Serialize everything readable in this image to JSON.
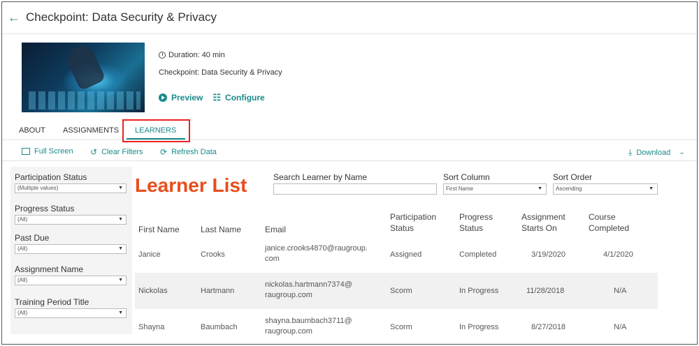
{
  "header": {
    "title": "Checkpoint: Data Security & Privacy"
  },
  "course": {
    "duration": "Duration: 40 min",
    "subtitle": "Checkpoint: Data Security & Privacy",
    "preview_label": "Preview",
    "configure_label": "Configure"
  },
  "tabs": [
    {
      "label": "ABOUT"
    },
    {
      "label": "ASSIGNMENTS"
    },
    {
      "label": "LEARNERS"
    }
  ],
  "toolbar": {
    "full_screen": "Full Screen",
    "clear_filters": "Clear Filters",
    "refresh_data": "Refresh Data",
    "download": "Download"
  },
  "filters": [
    {
      "label": "Participation Status",
      "value": "(Multiple values)"
    },
    {
      "label": "Progress Status",
      "value": "(All)"
    },
    {
      "label": "Past Due",
      "value": "(All)"
    },
    {
      "label": "Assignment Name",
      "value": "(All)"
    },
    {
      "label": "Training Period Title",
      "value": "(All)"
    }
  ],
  "learner_list_title": "Learner List",
  "search": {
    "label": "Search Learner by Name",
    "value": ""
  },
  "sort_column": {
    "label": "Sort Column",
    "value": "First Name"
  },
  "sort_order": {
    "label": "Sort Order",
    "value": "Ascending"
  },
  "table": {
    "columns": [
      {
        "l1": "",
        "l2": "First Name"
      },
      {
        "l1": "",
        "l2": "Last Name"
      },
      {
        "l1": "",
        "l2": "Email"
      },
      {
        "l1": "Participation",
        "l2": "Status"
      },
      {
        "l1": "Progress",
        "l2": "Status"
      },
      {
        "l1": "Assignment",
        "l2": "Starts On"
      },
      {
        "l1": "Course",
        "l2": "Completed"
      }
    ],
    "rows": [
      {
        "first": "Janice",
        "last": "Crooks",
        "email1": "janice.crooks4870@raugroup.",
        "email2": "com",
        "participation": "Assigned",
        "progress": "Completed",
        "starts": "3/19/2020",
        "completed": "4/1/2020"
      },
      {
        "first": "Nickolas",
        "last": "Hartmann",
        "email1": "nickolas.hartmann7374@",
        "email2": "raugroup.com",
        "participation": "Scorm",
        "progress": "In Progress",
        "starts": "11/28/2018",
        "completed": "N/A"
      },
      {
        "first": "Shayna",
        "last": "Baumbach",
        "email1": "shayna.baumbach3711@",
        "email2": "raugroup.com",
        "participation": "Scorm",
        "progress": "In Progress",
        "starts": "8/27/2018",
        "completed": "N/A"
      }
    ]
  },
  "colors": {
    "accent": "#1a8a8a",
    "title_orange": "#e84e1b",
    "highlight_red": "#e22"
  }
}
